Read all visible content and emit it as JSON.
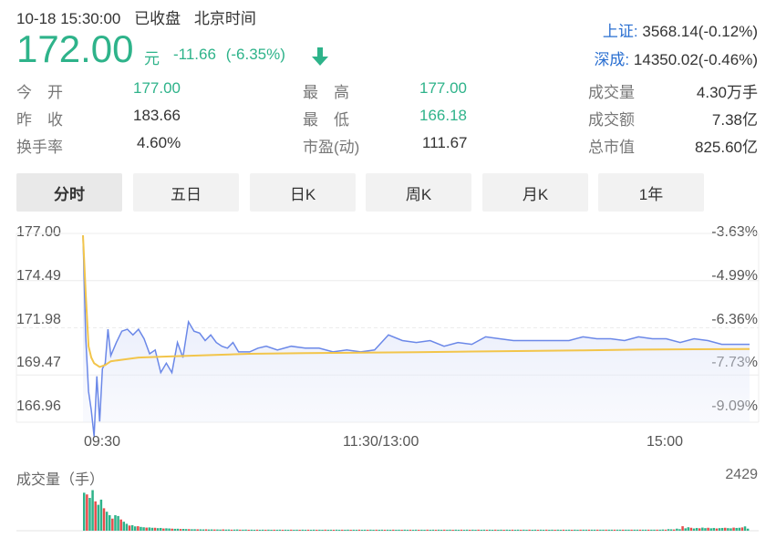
{
  "header": {
    "datetime": "10-18 15:30:00",
    "status": "已收盘",
    "timezone": "北京时间",
    "price": "172.00",
    "unit": "元",
    "change": "-11.66",
    "change_pct": "(-6.35%)",
    "down_arrow_icon": "arrow-down-icon",
    "color_down": "#2eb38a"
  },
  "indices": [
    {
      "label": "上证:",
      "value": "3568.14(-0.12%)"
    },
    {
      "label": "深成:",
      "value": "14350.02(-0.46%)"
    }
  ],
  "stats": {
    "col1": [
      {
        "label": "今　开",
        "value": "177.00",
        "green": true
      },
      {
        "label": "昨　收",
        "value": "183.66",
        "green": false
      },
      {
        "label": "换手率",
        "value": "4.60%",
        "green": false
      }
    ],
    "col2": [
      {
        "label": "最　高",
        "value": "177.00",
        "green": true
      },
      {
        "label": "最　低",
        "value": "166.18",
        "green": true
      },
      {
        "label": "市盈(动)",
        "value": "111.67",
        "green": false
      }
    ],
    "col3": [
      {
        "label": "成交量",
        "value": "4.30万手"
      },
      {
        "label": "成交额",
        "value": "7.38亿"
      },
      {
        "label": "总市值",
        "value": "825.60亿"
      }
    ]
  },
  "tabs": [
    "分时",
    "五日",
    "日K",
    "周K",
    "月K",
    "1年"
  ],
  "active_tab": "分时",
  "volume": {
    "title": "成交量（手）",
    "max_label": "2429"
  },
  "chart_data": {
    "type": "line",
    "y_left_ticks": [
      "177.00",
      "174.49",
      "171.98",
      "169.47",
      "166.96"
    ],
    "y_right_ticks": [
      "-3.63%",
      "-4.99%",
      "-6.36%",
      "-7.73%",
      "-9.09%"
    ],
    "x_ticks": [
      "09:30",
      "11:30/13:00",
      "15:00"
    ],
    "ylim": [
      166.96,
      177.0
    ],
    "series": [
      {
        "color": "#6b88e8",
        "x": [
          0,
          1,
          2,
          3,
          4,
          5,
          6,
          7,
          8,
          9,
          10,
          12,
          14,
          16,
          18,
          20,
          22,
          24,
          26,
          28,
          30,
          32,
          34,
          36,
          38,
          40,
          42,
          44,
          46,
          48,
          50,
          52,
          54,
          56,
          58,
          60,
          63,
          66,
          70,
          75,
          80,
          85,
          90,
          95,
          100,
          105,
          110,
          115,
          120,
          125,
          130,
          135,
          140,
          145,
          150,
          155,
          160,
          165,
          170,
          175,
          180,
          185,
          190,
          195,
          200,
          205,
          210,
          215,
          220,
          225,
          230,
          235,
          240
        ],
        "y": [
          176.9,
          171.5,
          168.6,
          167.6,
          166.2,
          169.4,
          167.0,
          169.8,
          170.1,
          171.9,
          170.5,
          171.2,
          171.8,
          171.9,
          171.6,
          171.9,
          171.4,
          170.6,
          170.8,
          169.6,
          170.1,
          169.6,
          171.2,
          170.4,
          172.3,
          171.8,
          171.7,
          171.3,
          171.6,
          171.2,
          171.0,
          170.9,
          171.2,
          170.7,
          170.7,
          170.7,
          170.9,
          171.0,
          170.8,
          171.0,
          170.9,
          170.9,
          170.7,
          170.8,
          170.7,
          170.8,
          171.6,
          171.3,
          171.2,
          171.3,
          171.0,
          171.2,
          171.1,
          171.5,
          171.4,
          171.3,
          171.3,
          171.3,
          171.3,
          171.3,
          171.5,
          171.4,
          171.4,
          171.3,
          171.5,
          171.4,
          171.4,
          171.2,
          171.4,
          171.3,
          171.1,
          171.1,
          171.1
        ]
      },
      {
        "color": "#f2c54b",
        "x": [
          0,
          1,
          2,
          3,
          4,
          6,
          8,
          10,
          15,
          20,
          30,
          40,
          50,
          60,
          80,
          100,
          120,
          140,
          160,
          180,
          200,
          220,
          240
        ],
        "y": [
          176.9,
          173.8,
          171.0,
          170.4,
          170.1,
          169.9,
          170.0,
          170.2,
          170.3,
          170.4,
          170.45,
          170.5,
          170.55,
          170.6,
          170.63,
          170.66,
          170.68,
          170.72,
          170.75,
          170.78,
          170.82,
          170.84,
          170.85
        ]
      }
    ],
    "volume": {
      "max": 2429,
      "values": [
        2200,
        2100,
        1900,
        2350,
        1700,
        1500,
        1800,
        1300,
        1100,
        900,
        700,
        900,
        850,
        650,
        520,
        400,
        300,
        320,
        250,
        260,
        220,
        200,
        180,
        190,
        170,
        170,
        150,
        160,
        130,
        140,
        130,
        120,
        110,
        115,
        100,
        105,
        95,
        90,
        85,
        85,
        80,
        80,
        75,
        80,
        70,
        75,
        70,
        70,
        65,
        75,
        65,
        70,
        60,
        65,
        70,
        60,
        60,
        65,
        55,
        60,
        55,
        60,
        55,
        60,
        55,
        60,
        55,
        58,
        55,
        60,
        55,
        58,
        55,
        60,
        55,
        58,
        55,
        60,
        55,
        58,
        55,
        60,
        55,
        58,
        55,
        60,
        55,
        58,
        55,
        60,
        55,
        58,
        55,
        60,
        55,
        58,
        55,
        60,
        55,
        58,
        55,
        60,
        55,
        58,
        55,
        60,
        55,
        58,
        55,
        60,
        55,
        58,
        55,
        60,
        55,
        58,
        55,
        60,
        55,
        58,
        55,
        60,
        55,
        60,
        55,
        60,
        55,
        60,
        55,
        60,
        55,
        60,
        55,
        60,
        55,
        60,
        55,
        60,
        55,
        60,
        55,
        60,
        55,
        60,
        55,
        60,
        55,
        60,
        55,
        60,
        55,
        60,
        55,
        60,
        55,
        60,
        55,
        60,
        55,
        60,
        55,
        60,
        55,
        60,
        55,
        60,
        55,
        60,
        55,
        60,
        55,
        60,
        55,
        60,
        55,
        60,
        60,
        60,
        60,
        60,
        60,
        60,
        60,
        60,
        60,
        60,
        60,
        60,
        60,
        60,
        60,
        60,
        60,
        60,
        60,
        60,
        60,
        60,
        60,
        60,
        60,
        60,
        60,
        60,
        70,
        60,
        90,
        80,
        70,
        120,
        90,
        260,
        140,
        200,
        170,
        130,
        160,
        140,
        180,
        150,
        170,
        140,
        160,
        130,
        150,
        160,
        170,
        150,
        140,
        180,
        160,
        170,
        190,
        250,
        120
      ],
      "up_color": "#e84c4c",
      "down_color": "#2eb38a"
    }
  }
}
